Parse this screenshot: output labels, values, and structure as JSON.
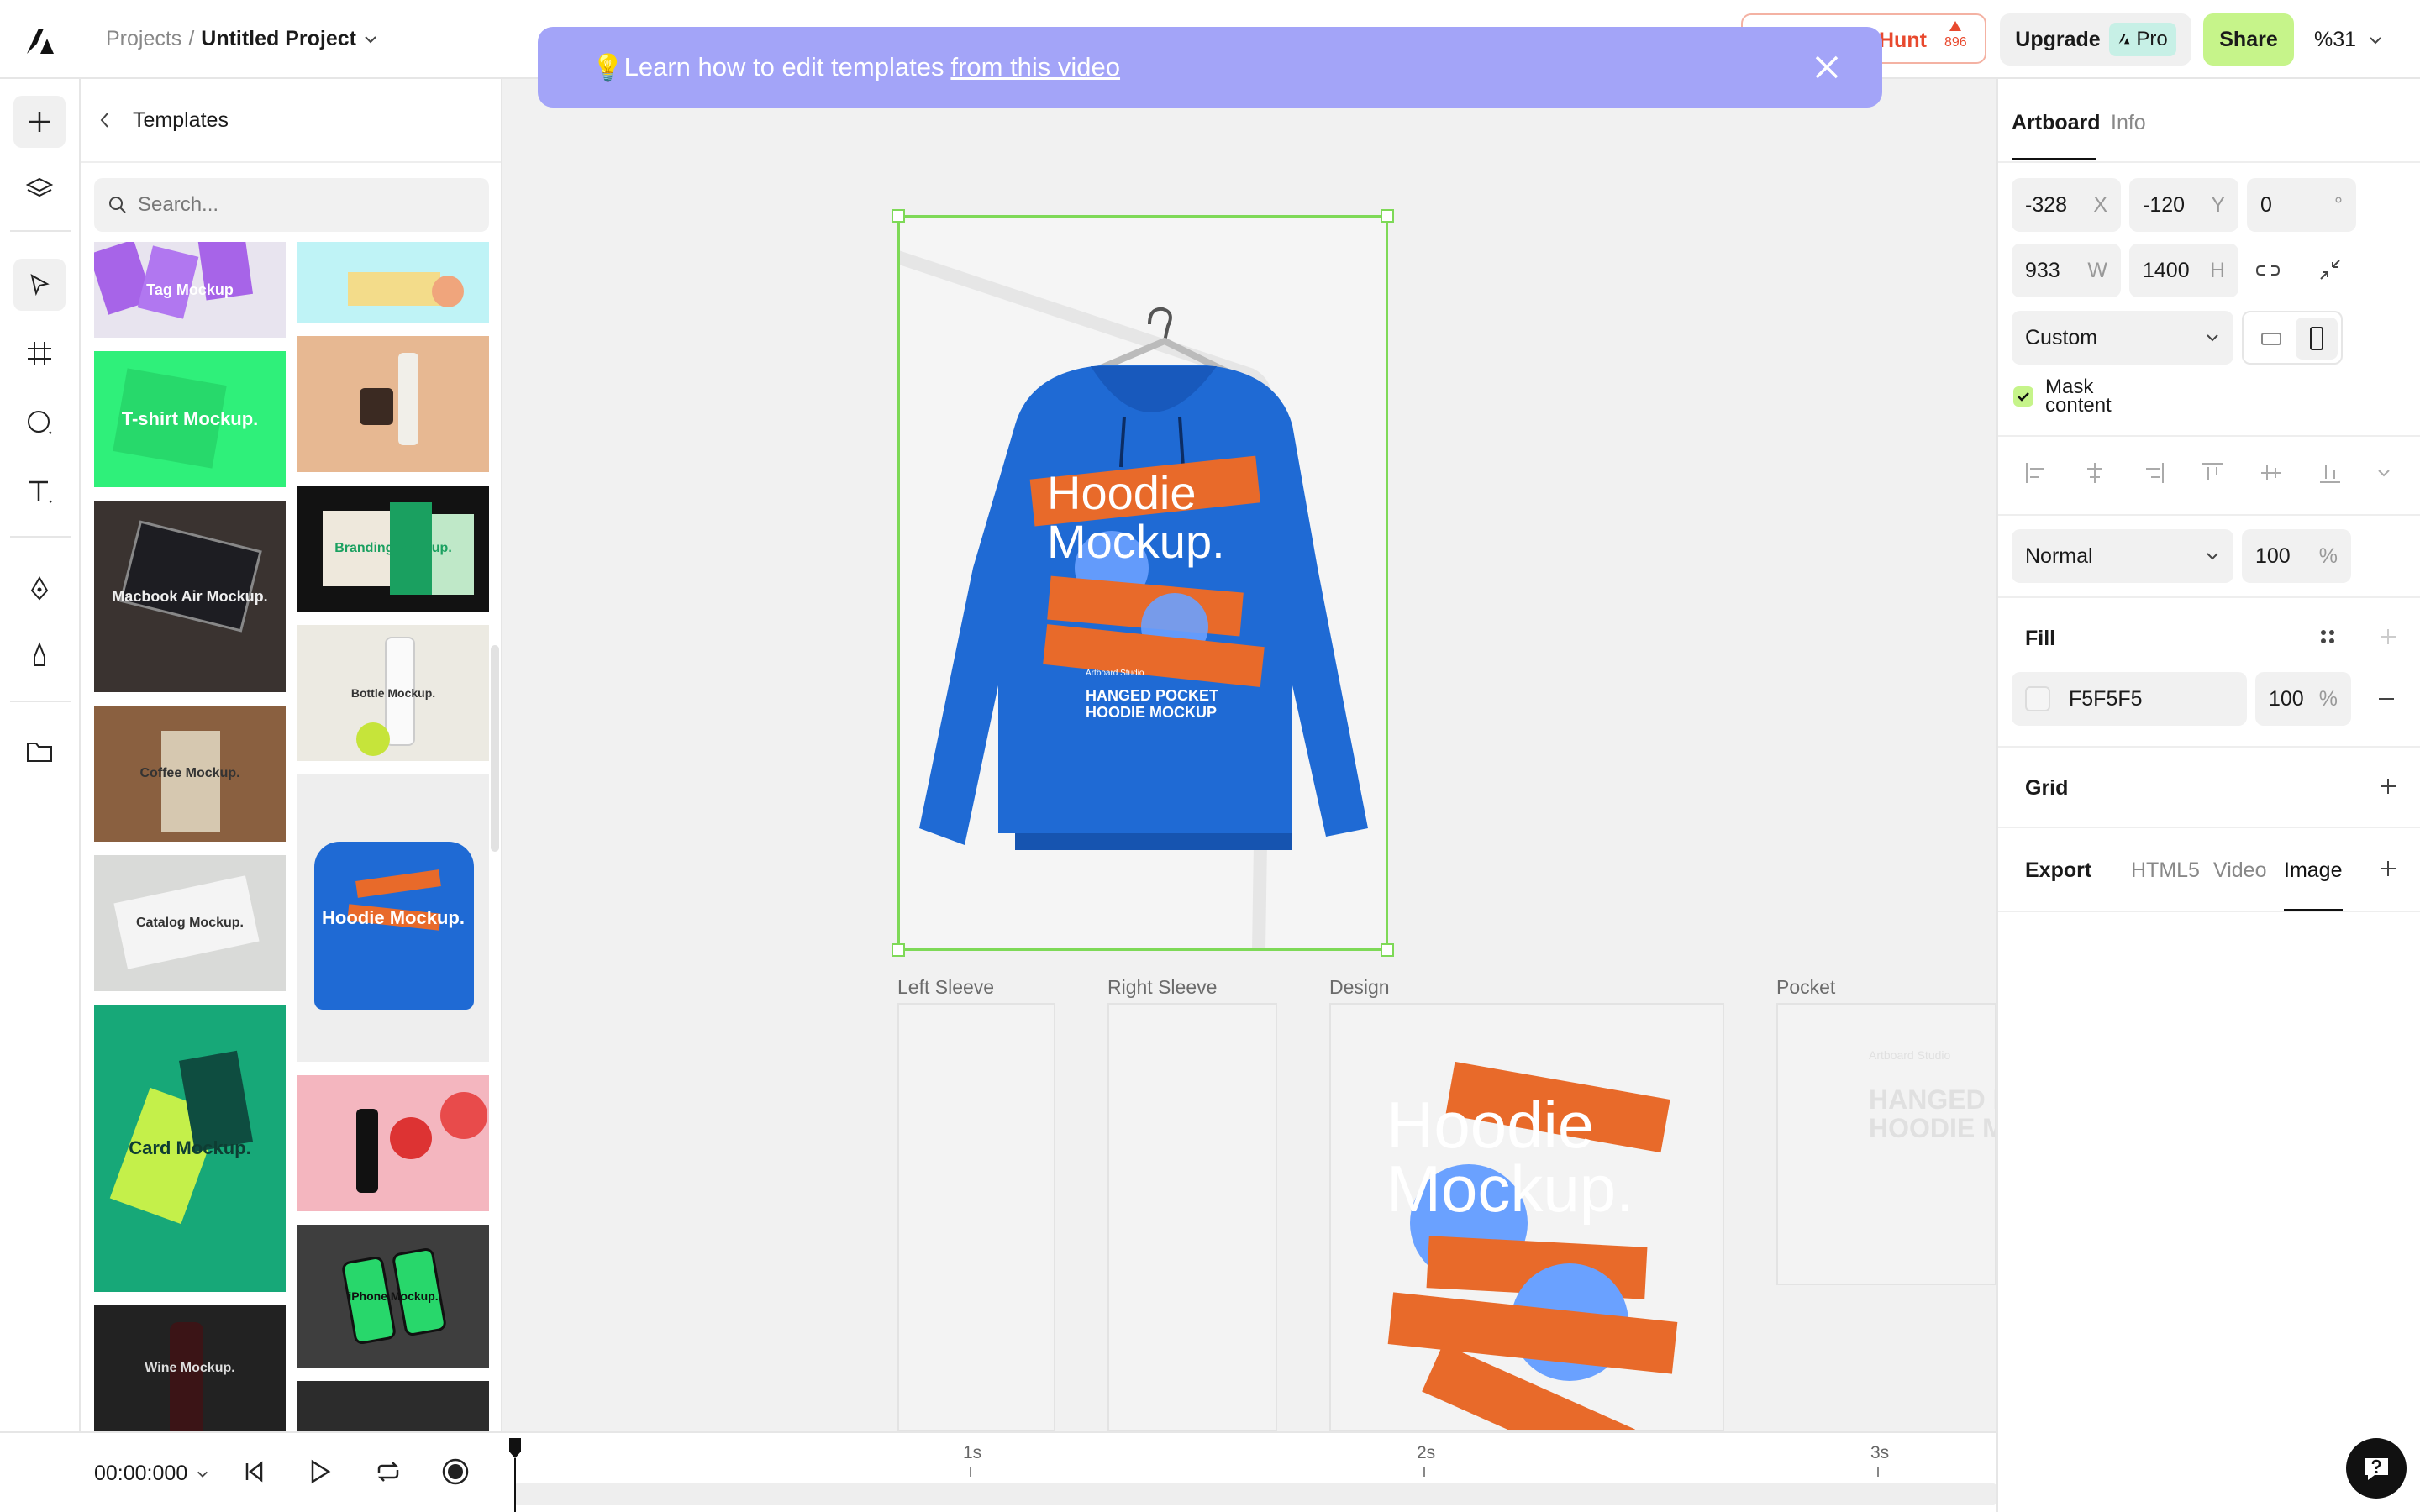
{
  "app": {
    "breadcrumb_root": "Projects",
    "breadcrumb_sep": "/",
    "project_name": "Untitled Project"
  },
  "header": {
    "producthunt_name": "Hunt",
    "producthunt_votes": "896",
    "upgrade_label": "Upgrade",
    "pro_label": "Pro",
    "share_label": "Share",
    "zoom": "%31"
  },
  "templates_panel": {
    "title": "Templates",
    "search_placeholder": "Search...",
    "items": [
      {
        "label": "Tag Mockup",
        "bg": "#e8e4ef"
      },
      {
        "label": "",
        "bg": "#bff3f6"
      },
      {
        "label": "T-shirt Mockup.",
        "bg": "#2ff07a"
      },
      {
        "label": "",
        "bg": "#e7b892"
      },
      {
        "label": "Macbook Air Mockup.",
        "bg": "#3a3330"
      },
      {
        "label": "Branding Mockup.",
        "bg": "#121212"
      },
      {
        "label": "Coffee Mockup.",
        "bg": "#8a6040"
      },
      {
        "label": "Bottle Mockup.",
        "bg": "#eceae2"
      },
      {
        "label": "Catalog Mockup.",
        "bg": "#d9dad8"
      },
      {
        "label": "Hoodie Mockup.",
        "bg": "#eeeeee"
      },
      {
        "label": "Card Mockup.",
        "bg": "#17a878"
      },
      {
        "label": "",
        "bg": "#f4b6bf"
      },
      {
        "label": "iPhone Mockup.",
        "bg": "#3e3e3e"
      },
      {
        "label": "Wine Mockup.",
        "bg": "#222222"
      },
      {
        "label": "",
        "bg": "#2c2c2c"
      }
    ]
  },
  "banner": {
    "icon": "💡",
    "text": "Learn how to edit templates",
    "link_text": "from this video"
  },
  "artboard": {
    "hoodie_title_line1": "Hoodie",
    "hoodie_title_line2": "Mockup.",
    "brand_small": "Artboard Studio",
    "caption_line1": "HANGED POCKET",
    "caption_line2": "HOODIE MOCKUP",
    "hoodie_color": "#1f6ad4",
    "accent_color": "#e86a2a",
    "selection_color": "#7ed957"
  },
  "sub_artboards": [
    {
      "label": "Left Sleeve"
    },
    {
      "label": "Right Sleeve"
    },
    {
      "label": "Design"
    },
    {
      "label": "Pocket"
    }
  ],
  "design_artboard": {
    "line1": "Hoodie",
    "line2": "Mockup."
  },
  "pocket_artboard": {
    "brand": "Artboard Studio",
    "line1": "HANGED P",
    "line2": "HOODIE M"
  },
  "right_panel": {
    "tabs": [
      "Artboard",
      "Info"
    ],
    "x_value": "-328",
    "x_unit": "X",
    "y_value": "-120",
    "y_unit": "Y",
    "rotation_value": "0",
    "rotation_unit": "°",
    "w_value": "933",
    "w_unit": "W",
    "h_value": "1400",
    "h_unit": "H",
    "preset": "Custom",
    "mask_label_1": "Mask",
    "mask_label_2": "content",
    "blend_mode": "Normal",
    "opacity_value": "100",
    "opacity_unit": "%",
    "fill_title": "Fill",
    "fill_hex": "F5F5F5",
    "fill_opacity": "100",
    "fill_unit": "%",
    "grid_title": "Grid",
    "export_title": "Export",
    "export_tabs": [
      "HTML5",
      "Video",
      "Image"
    ]
  },
  "timeline": {
    "time": "00:00:000",
    "ticks": [
      "1s",
      "2s",
      "3s"
    ]
  }
}
